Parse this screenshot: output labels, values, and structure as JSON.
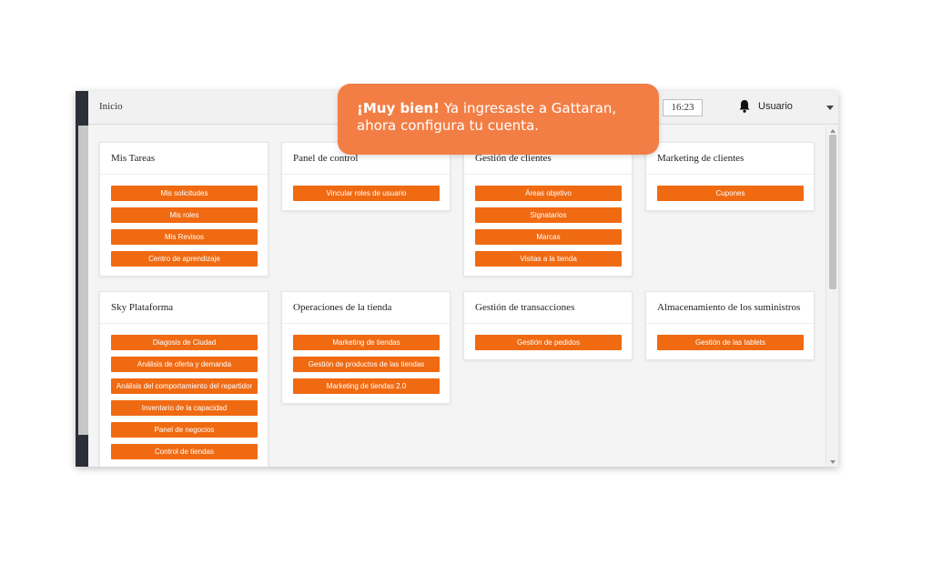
{
  "topbar": {
    "breadcrumb": "Inicio",
    "clock": "16:23",
    "user_label": "Usuario",
    "icons": {
      "notifications": "bell-icon",
      "user_menu": "chevron-down-icon"
    }
  },
  "toast": {
    "title": "¡Muy bien!",
    "line1": "Ya ingresaste a Gattaran,",
    "line2": "ahora configura tu cuenta."
  },
  "colors": {
    "accent": "#f06a12",
    "toast_bg": "#f37e45",
    "rail": "#2b2f38"
  },
  "cards": [
    {
      "title": "Mis Tareas",
      "buttons": [
        "Mis solicitudes",
        "Mis roles",
        "Mis Revisos",
        "Centro de aprendizaje"
      ]
    },
    {
      "title": "Panel de control",
      "buttons": [
        "Vincular roles de usuario"
      ]
    },
    {
      "title": "Gestión de clientes",
      "buttons": [
        "Áreas objetivo",
        "Signatarios",
        "Marcas",
        "Visitas a la tienda"
      ]
    },
    {
      "title": "Marketing de clientes",
      "buttons": [
        "Cupones"
      ]
    },
    {
      "title": "Sky Plataforma",
      "buttons": [
        "Diagosis de Ciudad",
        "Análisis de oferta y demanda",
        "Análisis del comportamiento del repartidor",
        "Inventario de la capacidad",
        "Panel de negocios",
        "Control de tiendas"
      ]
    },
    {
      "title": "Operaciones de la tienda",
      "buttons": [
        "Marketing de tiendas",
        "Gestión de productos de las tiendas",
        "Marketing de tiendas 2.0"
      ]
    },
    {
      "title": "Gestión de transacciones",
      "buttons": [
        "Gestión de pedidos"
      ]
    },
    {
      "title": "Almacenamiento de los suministros",
      "buttons": [
        "Gestión de las tablets"
      ]
    }
  ]
}
